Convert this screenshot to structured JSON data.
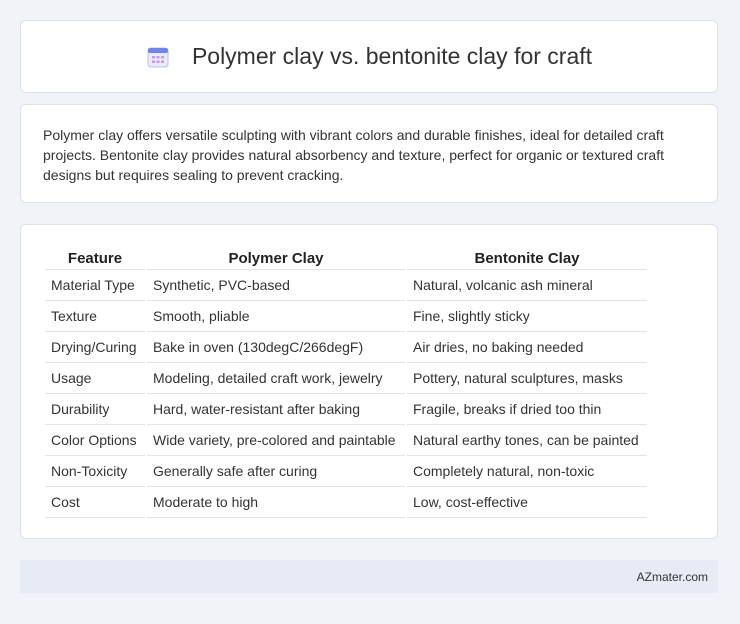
{
  "header": {
    "title": "Polymer clay vs. bentonite clay for craft",
    "icon": "calendar-icon"
  },
  "intro": {
    "text": "Polymer clay offers versatile sculpting with vibrant colors and durable finishes, ideal for detailed craft projects. Bentonite clay provides natural absorbency and texture, perfect for organic or textured craft designs but requires sealing to prevent cracking."
  },
  "table": {
    "headers": [
      "Feature",
      "Polymer Clay",
      "Bentonite Clay"
    ],
    "rows": [
      [
        "Material Type",
        "Synthetic, PVC-based",
        "Natural, volcanic ash mineral"
      ],
      [
        "Texture",
        "Smooth, pliable",
        "Fine, slightly sticky"
      ],
      [
        "Drying/Curing",
        "Bake in oven (130degC/266degF)",
        "Air dries, no baking needed"
      ],
      [
        "Usage",
        "Modeling, detailed craft work, jewelry",
        "Pottery, natural sculptures, masks"
      ],
      [
        "Durability",
        "Hard, water-resistant after baking",
        "Fragile, breaks if dried too thin"
      ],
      [
        "Color Options",
        "Wide variety, pre-colored and paintable",
        "Natural earthy tones, can be painted"
      ],
      [
        "Non-Toxicity",
        "Generally safe after curing",
        "Completely natural, non-toxic"
      ],
      [
        "Cost",
        "Moderate to high",
        "Low, cost-effective"
      ]
    ]
  },
  "footer": {
    "brand": "AZmater.com"
  },
  "colors": {
    "background": "#f1f3f8",
    "card": "#ffffff",
    "footer": "#e6ebf6",
    "icon_accent": "#7b8fe0"
  }
}
